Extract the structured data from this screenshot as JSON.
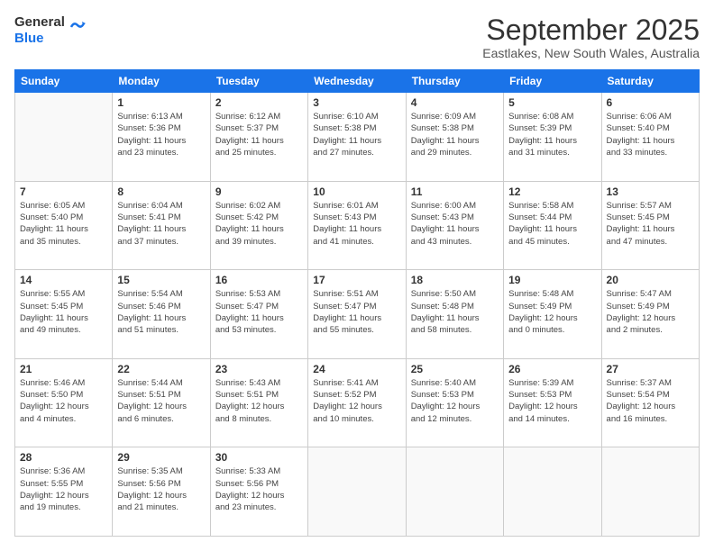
{
  "header": {
    "logo_general": "General",
    "logo_blue": "Blue",
    "month": "September 2025",
    "location": "Eastlakes, New South Wales, Australia"
  },
  "days_of_week": [
    "Sunday",
    "Monday",
    "Tuesday",
    "Wednesday",
    "Thursday",
    "Friday",
    "Saturday"
  ],
  "weeks": [
    [
      {
        "day": "",
        "info": ""
      },
      {
        "day": "1",
        "info": "Sunrise: 6:13 AM\nSunset: 5:36 PM\nDaylight: 11 hours\nand 23 minutes."
      },
      {
        "day": "2",
        "info": "Sunrise: 6:12 AM\nSunset: 5:37 PM\nDaylight: 11 hours\nand 25 minutes."
      },
      {
        "day": "3",
        "info": "Sunrise: 6:10 AM\nSunset: 5:38 PM\nDaylight: 11 hours\nand 27 minutes."
      },
      {
        "day": "4",
        "info": "Sunrise: 6:09 AM\nSunset: 5:38 PM\nDaylight: 11 hours\nand 29 minutes."
      },
      {
        "day": "5",
        "info": "Sunrise: 6:08 AM\nSunset: 5:39 PM\nDaylight: 11 hours\nand 31 minutes."
      },
      {
        "day": "6",
        "info": "Sunrise: 6:06 AM\nSunset: 5:40 PM\nDaylight: 11 hours\nand 33 minutes."
      }
    ],
    [
      {
        "day": "7",
        "info": "Sunrise: 6:05 AM\nSunset: 5:40 PM\nDaylight: 11 hours\nand 35 minutes."
      },
      {
        "day": "8",
        "info": "Sunrise: 6:04 AM\nSunset: 5:41 PM\nDaylight: 11 hours\nand 37 minutes."
      },
      {
        "day": "9",
        "info": "Sunrise: 6:02 AM\nSunset: 5:42 PM\nDaylight: 11 hours\nand 39 minutes."
      },
      {
        "day": "10",
        "info": "Sunrise: 6:01 AM\nSunset: 5:43 PM\nDaylight: 11 hours\nand 41 minutes."
      },
      {
        "day": "11",
        "info": "Sunrise: 6:00 AM\nSunset: 5:43 PM\nDaylight: 11 hours\nand 43 minutes."
      },
      {
        "day": "12",
        "info": "Sunrise: 5:58 AM\nSunset: 5:44 PM\nDaylight: 11 hours\nand 45 minutes."
      },
      {
        "day": "13",
        "info": "Sunrise: 5:57 AM\nSunset: 5:45 PM\nDaylight: 11 hours\nand 47 minutes."
      }
    ],
    [
      {
        "day": "14",
        "info": "Sunrise: 5:55 AM\nSunset: 5:45 PM\nDaylight: 11 hours\nand 49 minutes."
      },
      {
        "day": "15",
        "info": "Sunrise: 5:54 AM\nSunset: 5:46 PM\nDaylight: 11 hours\nand 51 minutes."
      },
      {
        "day": "16",
        "info": "Sunrise: 5:53 AM\nSunset: 5:47 PM\nDaylight: 11 hours\nand 53 minutes."
      },
      {
        "day": "17",
        "info": "Sunrise: 5:51 AM\nSunset: 5:47 PM\nDaylight: 11 hours\nand 55 minutes."
      },
      {
        "day": "18",
        "info": "Sunrise: 5:50 AM\nSunset: 5:48 PM\nDaylight: 11 hours\nand 58 minutes."
      },
      {
        "day": "19",
        "info": "Sunrise: 5:48 AM\nSunset: 5:49 PM\nDaylight: 12 hours\nand 0 minutes."
      },
      {
        "day": "20",
        "info": "Sunrise: 5:47 AM\nSunset: 5:49 PM\nDaylight: 12 hours\nand 2 minutes."
      }
    ],
    [
      {
        "day": "21",
        "info": "Sunrise: 5:46 AM\nSunset: 5:50 PM\nDaylight: 12 hours\nand 4 minutes."
      },
      {
        "day": "22",
        "info": "Sunrise: 5:44 AM\nSunset: 5:51 PM\nDaylight: 12 hours\nand 6 minutes."
      },
      {
        "day": "23",
        "info": "Sunrise: 5:43 AM\nSunset: 5:51 PM\nDaylight: 12 hours\nand 8 minutes."
      },
      {
        "day": "24",
        "info": "Sunrise: 5:41 AM\nSunset: 5:52 PM\nDaylight: 12 hours\nand 10 minutes."
      },
      {
        "day": "25",
        "info": "Sunrise: 5:40 AM\nSunset: 5:53 PM\nDaylight: 12 hours\nand 12 minutes."
      },
      {
        "day": "26",
        "info": "Sunrise: 5:39 AM\nSunset: 5:53 PM\nDaylight: 12 hours\nand 14 minutes."
      },
      {
        "day": "27",
        "info": "Sunrise: 5:37 AM\nSunset: 5:54 PM\nDaylight: 12 hours\nand 16 minutes."
      }
    ],
    [
      {
        "day": "28",
        "info": "Sunrise: 5:36 AM\nSunset: 5:55 PM\nDaylight: 12 hours\nand 19 minutes."
      },
      {
        "day": "29",
        "info": "Sunrise: 5:35 AM\nSunset: 5:56 PM\nDaylight: 12 hours\nand 21 minutes."
      },
      {
        "day": "30",
        "info": "Sunrise: 5:33 AM\nSunset: 5:56 PM\nDaylight: 12 hours\nand 23 minutes."
      },
      {
        "day": "",
        "info": ""
      },
      {
        "day": "",
        "info": ""
      },
      {
        "day": "",
        "info": ""
      },
      {
        "day": "",
        "info": ""
      }
    ]
  ]
}
